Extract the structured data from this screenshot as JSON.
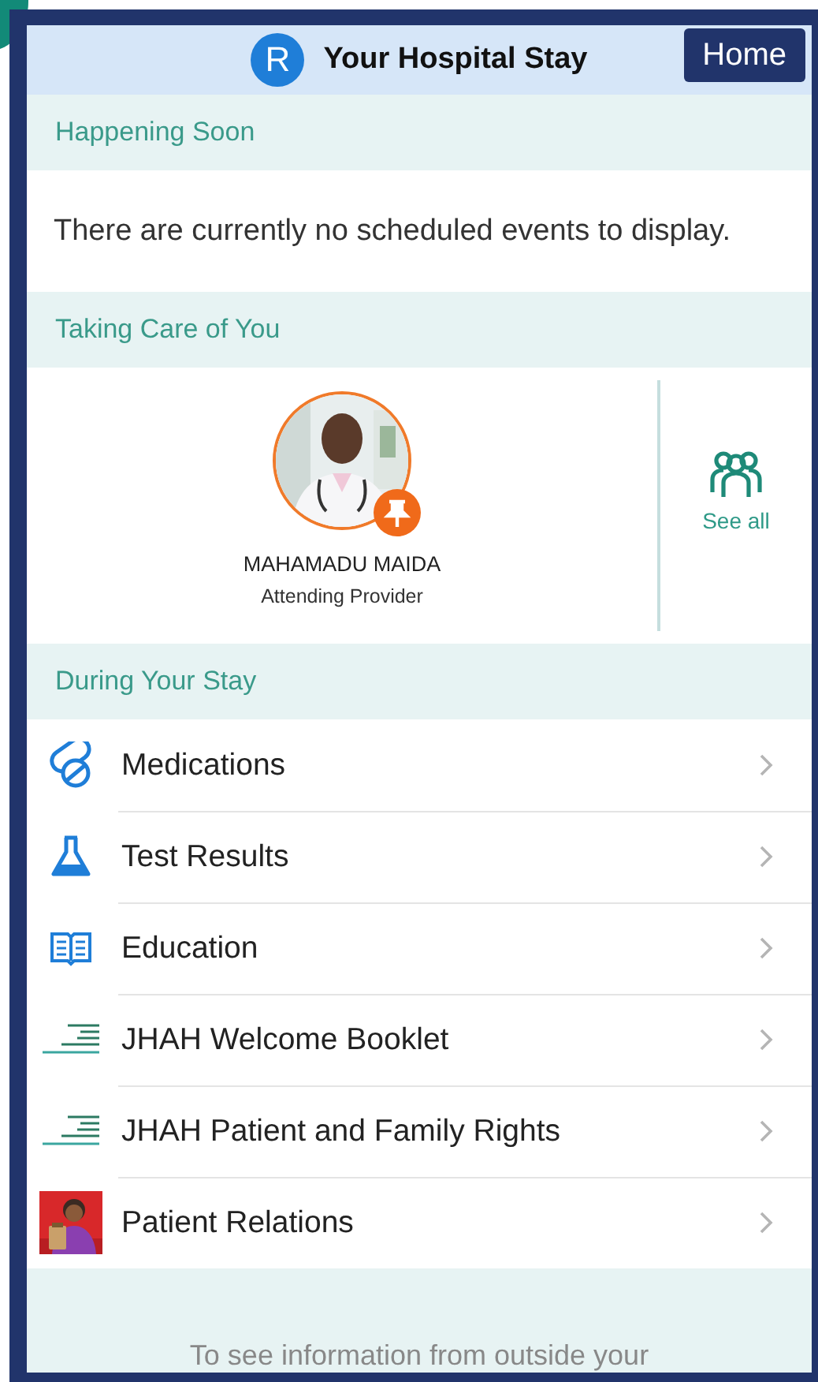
{
  "header": {
    "avatar_letter": "R",
    "title": "Your Hospital Stay",
    "home_button": "Home"
  },
  "happening_soon": {
    "title": "Happening Soon",
    "message": "There are currently no scheduled events to display."
  },
  "care_team": {
    "title": "Taking Care of You",
    "provider": {
      "name": "MAHAMADU MAIDA",
      "role": "Attending Provider",
      "pinned": true
    },
    "see_all": "See all"
  },
  "during_stay": {
    "title": "During Your Stay",
    "items": [
      {
        "label": "Medications",
        "kind": "pill"
      },
      {
        "label": "Test Results",
        "kind": "flask"
      },
      {
        "label": "Education",
        "kind": "book"
      },
      {
        "label": "JHAH Welcome Booklet",
        "kind": "logo"
      },
      {
        "label": "JHAH Patient and Family Rights",
        "kind": "logo"
      },
      {
        "label": "Patient Relations",
        "kind": "picture"
      }
    ]
  },
  "footer_note": "To see information from outside your"
}
